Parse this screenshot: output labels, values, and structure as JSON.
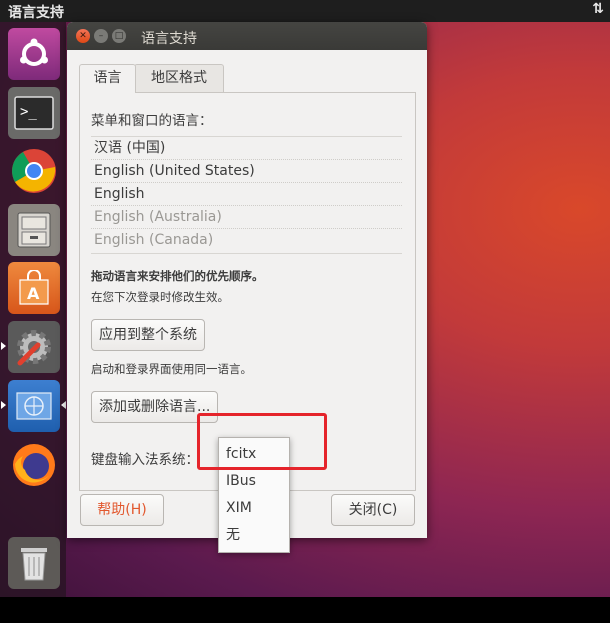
{
  "topbar": {
    "title": "语言支持",
    "network_icon": "network-arrows-icon"
  },
  "launcher": {
    "items": [
      {
        "name": "ubuntu-dash",
        "icon": "ubuntu-logo-icon"
      },
      {
        "name": "terminal",
        "icon": "terminal-icon"
      },
      {
        "name": "chrome",
        "icon": "chrome-icon"
      },
      {
        "name": "files",
        "icon": "file-cabinet-icon"
      },
      {
        "name": "software",
        "icon": "software-center-icon"
      },
      {
        "name": "settings",
        "icon": "system-settings-icon"
      },
      {
        "name": "language-support",
        "icon": "language-support-icon"
      },
      {
        "name": "firefox",
        "icon": "firefox-icon"
      },
      {
        "name": "trash",
        "icon": "trash-icon"
      }
    ]
  },
  "window": {
    "title": "语言支持",
    "tabs": [
      "语言",
      "地区格式"
    ],
    "menu_lang_label": "菜单和窗口的语言：",
    "languages": [
      "汉语 (中国)",
      "English (United States)",
      "English",
      "English (Australia)",
      "English (Canada)"
    ],
    "drag_hint_bold": "拖动语言来安排他们的优先顺序。",
    "drag_hint": "在您下次登录时修改生效。",
    "apply_button": "应用到整个系统",
    "login_hint": "启动和登录界面使用同一语言。",
    "add_remove_button": "添加或删除语言...",
    "keyboard_label": "键盘输入法系统：",
    "help_button": "帮助(H)",
    "close_button": "关闭(C)"
  },
  "dropdown": {
    "options": [
      "fcitx",
      "IBus",
      "XIM",
      "无"
    ],
    "selected": "fcitx"
  },
  "colors": {
    "accent": "#e2582e",
    "highlight_box": "#e5242b",
    "titlebar": "#3c3b37"
  }
}
